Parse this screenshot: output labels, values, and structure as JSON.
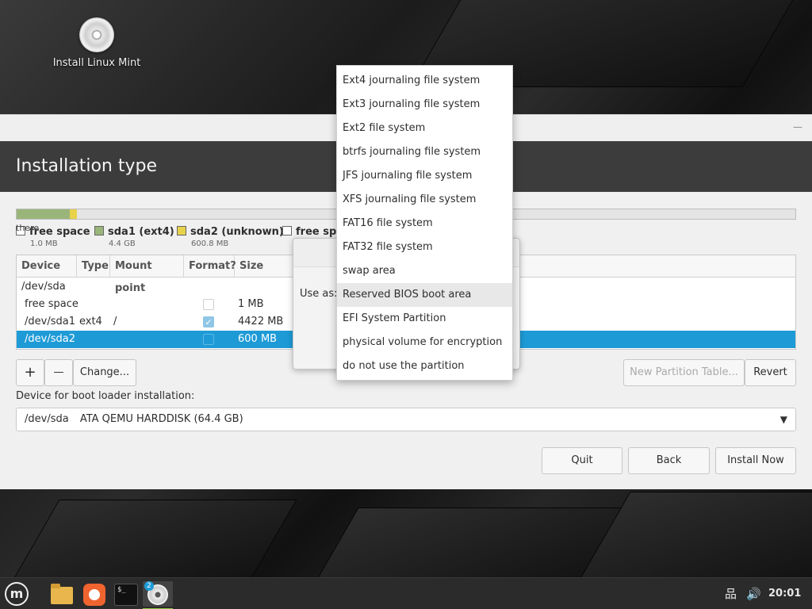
{
  "desktop": {
    "icon_label": "Install Linux Mint",
    "icon": "disc-icon"
  },
  "window": {
    "title": "Installation type"
  },
  "partition_bar": {
    "segments": [
      {
        "color": "#9ab57a",
        "fraction": 0.0005
      },
      {
        "color": "#9ab57a",
        "fraction": 0.068
      },
      {
        "color": "#e8d24a",
        "fraction": 0.0093
      },
      {
        "color": "#e4e4e4",
        "fraction": 0.9222
      }
    ]
  },
  "legend": {
    "warning": "there",
    "items": [
      {
        "name": "free space",
        "size": "1.0 MB",
        "color": "#ffffff"
      },
      {
        "name": "sda1 (ext4)",
        "size": "4.4 GB",
        "color": "#9ab57a"
      },
      {
        "name": "sda2 (unknown)",
        "size": "600.8 MB",
        "color": "#e8d24a"
      },
      {
        "name": "free spa",
        "size": "",
        "color": "#ffffff"
      }
    ]
  },
  "table": {
    "headers": [
      "Device",
      "Type",
      "Mount point",
      "Format?",
      "Size"
    ],
    "rows": [
      {
        "device": "/dev/sda",
        "type": "",
        "mount": "",
        "format": null,
        "size": ""
      },
      {
        "device": "free space",
        "type": "",
        "mount": "",
        "format": false,
        "size": "1 MB"
      },
      {
        "device": "/dev/sda1",
        "type": "ext4",
        "mount": "/",
        "format": true,
        "size": "4422 MB"
      },
      {
        "device": "/dev/sda2",
        "type": "",
        "mount": "",
        "format": false,
        "size": "600 MB",
        "selected": true
      }
    ]
  },
  "toolbar": {
    "add": "+",
    "remove": "—",
    "change": "Change...",
    "new_table": "New Partition Table...",
    "revert": "Revert"
  },
  "bootloader": {
    "label": "Device for boot loader installation:",
    "device": "/dev/sda",
    "description": "ATA QEMU HARDDISK (64.4 GB)"
  },
  "actions": {
    "quit": "Quit",
    "back": "Back",
    "install": "Install Now"
  },
  "dialog": {
    "use_as_label": "Use as:"
  },
  "use_as_menu": {
    "items": [
      "Ext4 journaling file system",
      "Ext3 journaling file system",
      "Ext2 file system",
      "btrfs journaling file system",
      "JFS journaling file system",
      "XFS journaling file system",
      "FAT16 file system",
      "FAT32 file system",
      "swap area",
      "Reserved BIOS boot area",
      "EFI System Partition",
      "physical volume for encryption",
      "do not use the partition"
    ],
    "hovered_index": 9
  },
  "taskbar": {
    "installer_badge": "2",
    "terminal_glyph": "$_",
    "mint_glyph": "m",
    "network_icon": "network-icon",
    "volume_icon": "volume-icon",
    "network_glyph": "品",
    "volume_glyph": "🔊",
    "clock": "20:01"
  }
}
